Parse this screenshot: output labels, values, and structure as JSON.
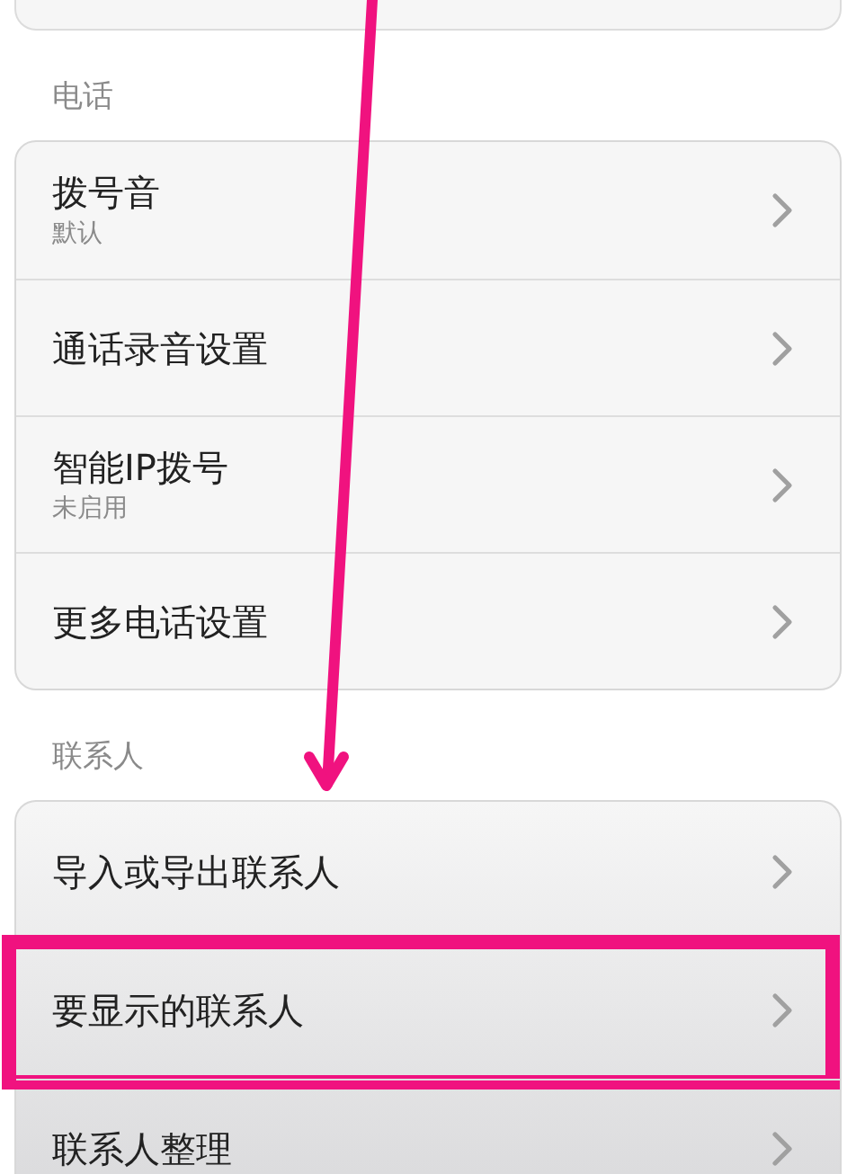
{
  "sections": [
    {
      "title": "电话",
      "items": [
        {
          "title": "拨号音",
          "subtitle": "默认",
          "highlighted": false
        },
        {
          "title": "通话录音设置",
          "highlighted": false
        },
        {
          "title": "智能IP拨号",
          "subtitle": "未启用",
          "highlighted": false
        },
        {
          "title": "更多电话设置",
          "highlighted": false
        }
      ]
    },
    {
      "title": "联系人",
      "items": [
        {
          "title": "导入或导出联系人",
          "highlighted": false
        },
        {
          "title": "要显示的联系人",
          "highlighted": true
        },
        {
          "title": "联系人整理",
          "highlighted": false
        }
      ]
    }
  ]
}
